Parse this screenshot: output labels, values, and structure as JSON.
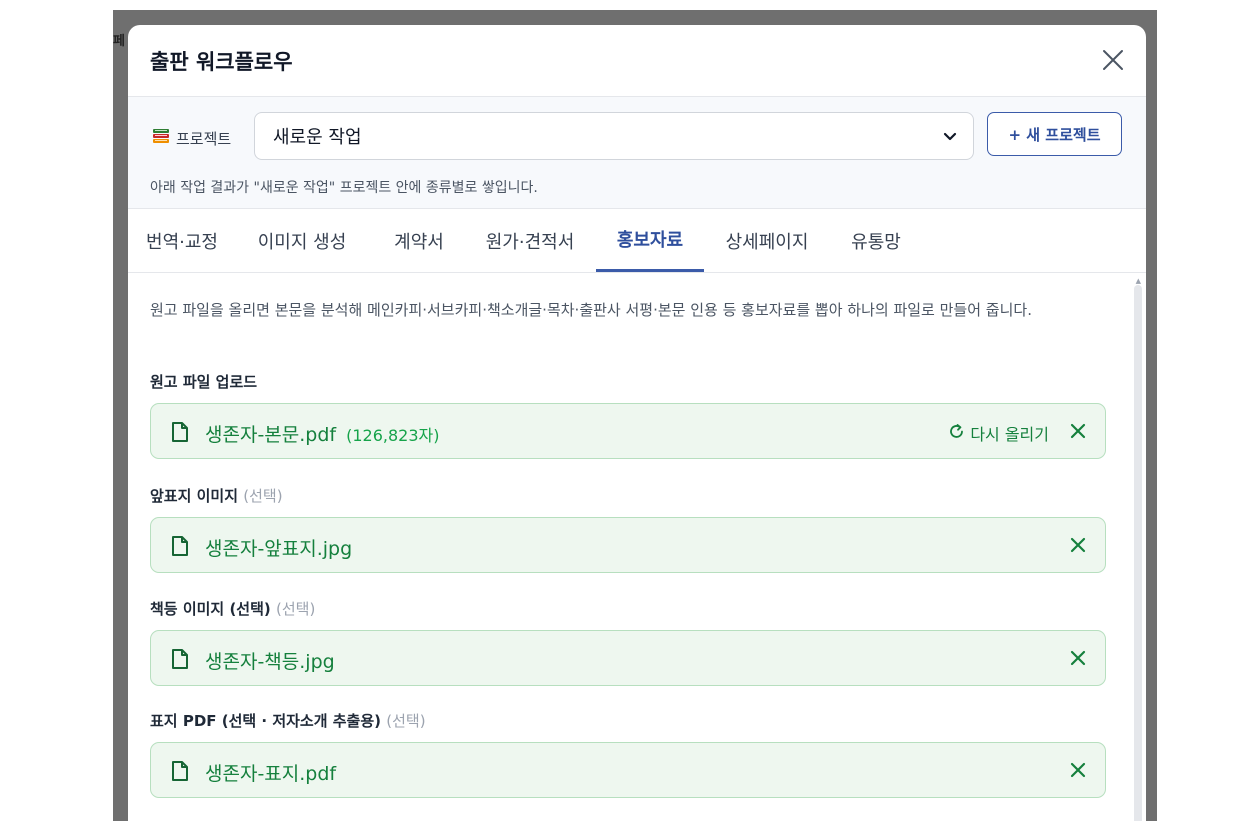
{
  "background": {
    "edge_text": "페"
  },
  "modal": {
    "title": "출판 워크플로우",
    "close_icon": "close-icon"
  },
  "project": {
    "label": "프로젝트",
    "icon": "books-icon",
    "selected": "새로운 작업",
    "new_button": "+ 새 프로젝트",
    "hint": "아래 작업 결과가 \"새로운 작업\" 프로젝트 안에 종류별로 쌓입니다."
  },
  "tabs": [
    {
      "label": "번역·교정"
    },
    {
      "label": "이미지 생성"
    },
    {
      "label": "계약서"
    },
    {
      "label": "원가·견적서"
    },
    {
      "label": "홍보자료",
      "active": true
    },
    {
      "label": "상세페이지"
    },
    {
      "label": "유통망"
    }
  ],
  "content": {
    "description": "원고 파일을 올리면 본문을 분석해 메인카피·서브카피·책소개글·목차·출판사 서평·본문 인용 등 홍보자료를 뽑아 하나의 파일로 만들어 줍니다.",
    "fields": [
      {
        "label": "원고 파일 업로드",
        "optional": "",
        "file": "생존자-본문.pdf",
        "meta": "(126,823자)",
        "reupload": "다시 올리기"
      },
      {
        "label": "앞표지 이미지",
        "optional": "(선택)",
        "file": "생존자-앞표지.jpg"
      },
      {
        "label": "책등 이미지 (선택)",
        "optional": "(선택)",
        "file": "생존자-책등.jpg"
      },
      {
        "label": "표지 PDF (선택 · 저자소개 추출용)",
        "optional": "(선택)",
        "file": "생존자-표지.pdf"
      }
    ]
  },
  "colors": {
    "accent": "#3b5ba9",
    "file_bg": "#eef7ef",
    "file_border": "#b7dfbf",
    "file_text": "#15803d",
    "overlay": "#6f6f6f"
  }
}
